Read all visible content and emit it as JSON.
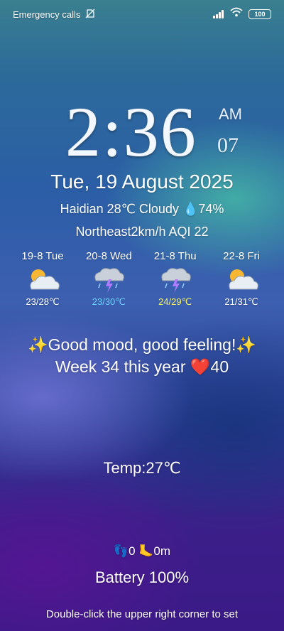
{
  "status_bar": {
    "left_text": "Emergency calls",
    "battery": "100"
  },
  "clock": {
    "time": "2:36",
    "ampm": "AM",
    "seconds": "07"
  },
  "date": "Tue, 19 August 2025",
  "weather": {
    "location": "Haidian",
    "temp": "28℃",
    "condition": "Cloudy",
    "humidity": "74%",
    "wind_dir": "Northeast",
    "wind_speed": "2km/h",
    "aqi": "AQI 22"
  },
  "forecast": [
    {
      "day": "19-8 Tue",
      "temp": "23/28℃",
      "icon": "partly-cloudy-icon",
      "color": "#ffffff"
    },
    {
      "day": "20-8 Wed",
      "temp": "23/30℃",
      "icon": "thunderstorm-icon",
      "color": "#6ad0ff"
    },
    {
      "day": "21-8 Thu",
      "temp": "24/29℃",
      "icon": "thunderstorm-icon",
      "color": "#f3f36a"
    },
    {
      "day": "22-8 Fri",
      "temp": "21/31℃",
      "icon": "partly-cloudy-icon",
      "color": "#ffffff"
    }
  ],
  "mood": "✨Good mood, good feeling!✨",
  "week_prefix": "Week 34 this year ",
  "week_heart": "❤️",
  "week_value": "40",
  "temp_label": "Temp:27℃",
  "steps_text": "👣0 🦶0m",
  "battery_text": "Battery 100%",
  "hint": "Double-click the upper right corner to set"
}
